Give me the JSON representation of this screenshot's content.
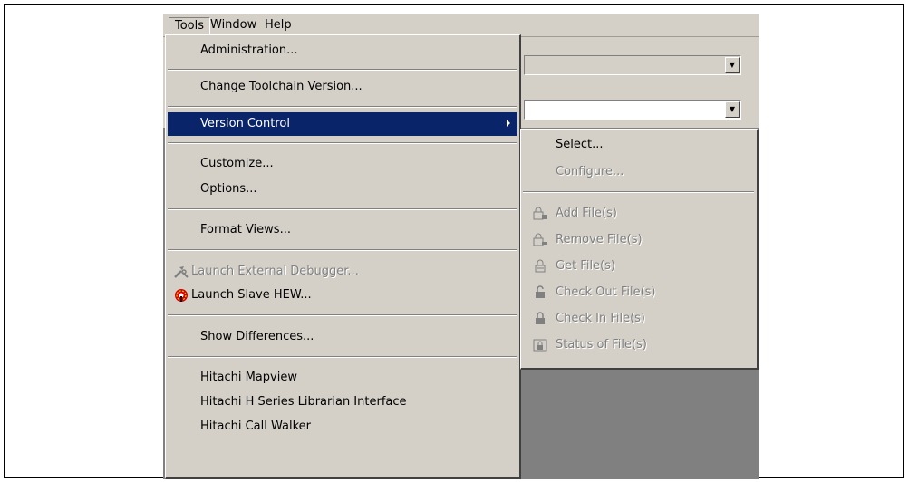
{
  "menubar": {
    "items": [
      {
        "label": "Tools"
      },
      {
        "label": "Window"
      },
      {
        "label": "Help"
      }
    ]
  },
  "tools_menu": {
    "administration": "Administration...",
    "change_toolchain": "Change Toolchain Version...",
    "version_control": "Version Control",
    "customize": "Customize...",
    "options": "Options...",
    "format_views": "Format Views...",
    "launch_external_debugger": "Launch External Debugger...",
    "launch_slave_hew": "Launch Slave HEW...",
    "show_differences": "Show Differences...",
    "hitachi_mapview": "Hitachi Mapview",
    "hitachi_librarian": "Hitachi H Series Librarian Interface",
    "hitachi_call_walker": "Hitachi Call Walker"
  },
  "version_control_submenu": {
    "select": "Select...",
    "configure": "Configure...",
    "add_files": "Add File(s)",
    "remove_files": "Remove File(s)",
    "get_files": "Get File(s)",
    "check_out_files": "Check Out File(s)",
    "check_in_files": "Check In File(s)",
    "status_of_files": "Status of File(s)"
  },
  "colors": {
    "menu_bg": "#d4d0c8",
    "highlight": "#0a246a",
    "disabled_text": "#808080",
    "workspace": "#808080"
  },
  "icons": {
    "launch_external_debugger": "hammer-wrench-icon",
    "launch_slave_hew": "red-gear-icon",
    "add_files": "add-file-lock-icon",
    "remove_files": "remove-file-lock-icon",
    "get_files": "get-file-icon",
    "check_out_files": "check-out-icon",
    "check_in_files": "check-in-icon",
    "status_of_files": "status-lock-icon"
  }
}
